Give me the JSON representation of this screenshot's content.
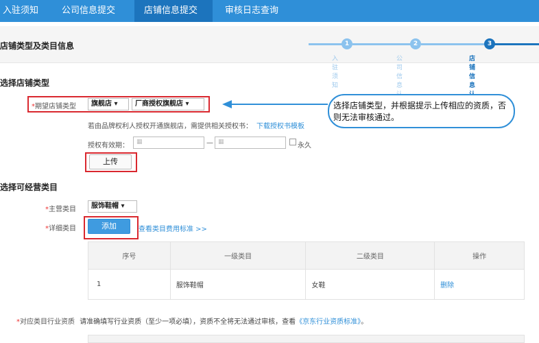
{
  "nav": {
    "items": [
      "入驻须知",
      "公司信息提交",
      "店铺信息提交",
      "审核日志查询"
    ],
    "active_index": 2
  },
  "panel": {
    "title": "店铺类型及类目信息",
    "steps": [
      {
        "num": "1",
        "label": "入驻须知"
      },
      {
        "num": "2",
        "label": "公司信息认证"
      },
      {
        "num": "3",
        "label": "店铺信息认证"
      }
    ],
    "current_step": 3
  },
  "store_type": {
    "heading": "选择店铺类型",
    "field_label": "期望店铺类型",
    "select1": "旗舰店",
    "select2": "厂商授权旗舰店",
    "hint": "若由品牌权利人授权开通旗舰店，需提供相关授权书：",
    "download_link": "下载授权书模板",
    "validity_label": "授权有效期：",
    "permanent_label": "永久",
    "range_sep": "—",
    "upload_label": "上传"
  },
  "callout": {
    "text": "选择店铺类型，并根据提示上传相应的资质，否则无法审核通过。"
  },
  "category": {
    "heading": "选择可经营类目",
    "main_label": "主营类目",
    "main_value": "服饰鞋帽",
    "detail_label": "详细类目",
    "add_label": "添加",
    "fee_link": "查看类目费用标准 >>",
    "table": {
      "headers": [
        "序号",
        "一级类目",
        "二级类目",
        "操作"
      ],
      "rows": [
        {
          "no": "1",
          "level1": "服饰鞋帽",
          "level2": "女鞋",
          "action": "删除"
        }
      ]
    }
  },
  "qualification": {
    "label": "对应类目行业资质",
    "text": "请准确填写行业资质（至少一项必填），资质不全将无法通过审核，查看",
    "link": "《京东行业资质标准》",
    "suffix": "。"
  },
  "colors": {
    "nav_bg": "#2f8fd8",
    "accent": "#2f8fd8",
    "highlight_red": "#d9272e"
  }
}
